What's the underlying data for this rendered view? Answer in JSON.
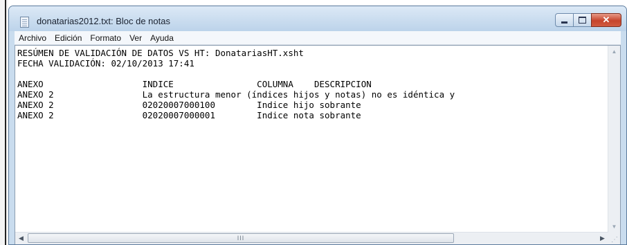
{
  "window": {
    "title": "donatarias2012.txt: Bloc de notas",
    "controls": {
      "minimize": "minimize",
      "maximize": "maximize",
      "close": "✕"
    }
  },
  "menu": [
    "Archivo",
    "Edición",
    "Formato",
    "Ver",
    "Ayuda"
  ],
  "document": {
    "lines": [
      "RESÚMEN DE VALIDACIÓN DE DATOS VS HT: DonatariasHT.xsht",
      "FECHA VALIDACIÓN: 02/10/2013 17:41",
      "",
      "ANEXO                   INDICE                COLUMNA    DESCRIPCION",
      "ANEXO 2                 La estructura menor (índices hijos y notas) no es idéntica y",
      "ANEXO 2                 02020007000100        Indice hijo sobrante",
      "ANEXO 2                 02020007000001        Indice nota sobrante"
    ]
  },
  "scrollbars": {
    "up_arrow": "▲",
    "down_arrow": "▼",
    "left_arrow": "◀",
    "right_arrow": "▶",
    "thumb_grip": "III"
  },
  "colors": {
    "titlebar": "#c9dcee",
    "close": "#c6442c",
    "text": "#000000"
  }
}
